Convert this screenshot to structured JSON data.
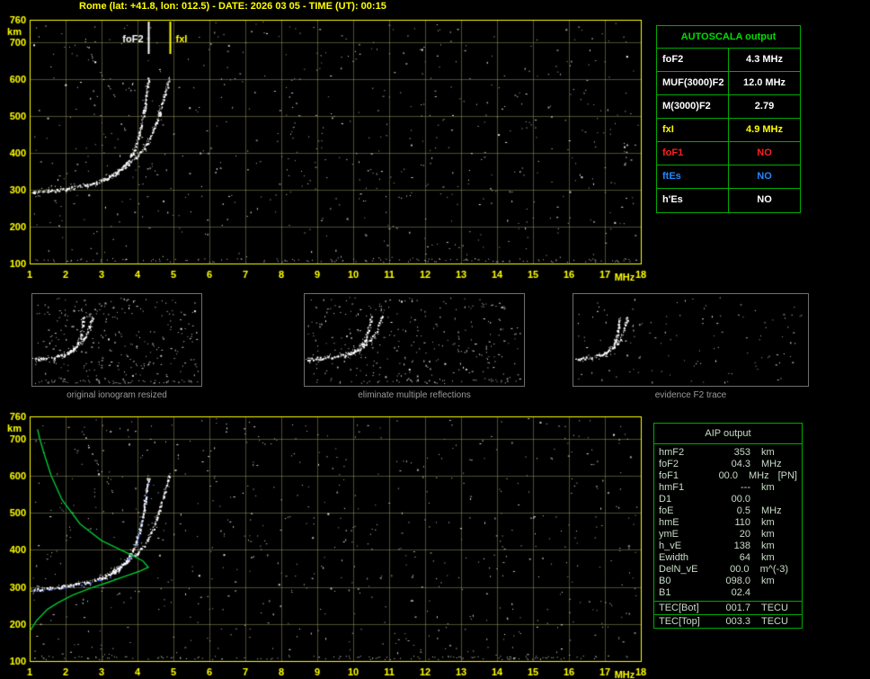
{
  "title": "Rome (lat: +41.8, lon: 012.5) - DATE: 2026 03 05 - TIME (UT): 00:15",
  "colors": {
    "background": "#000000",
    "axis_yellow": "#ffff00",
    "grid": "rgba(190,190,120,0.40)",
    "trace_white": "#ffffff",
    "profile_green": "#00c832",
    "restored_blue": "#4466ff",
    "table_green": "#00aa00",
    "table_header_green": "#00dd00",
    "caption_gray": "#9a9a9a",
    "aip_text": "#c8dcc8",
    "value_red": "#ff2020",
    "value_blue": "#2288ff",
    "value_yellow": "#ffff00",
    "value_white": "#ffffff"
  },
  "autoscala_table": {
    "header": "AUTOSCALA output",
    "rows": [
      {
        "label": "foF2",
        "value": "4.3 MHz",
        "color": "#ffffff"
      },
      {
        "label": "MUF(3000)F2",
        "value": "12.0 MHz",
        "color": "#ffffff"
      },
      {
        "label": "M(3000)F2",
        "value": "2.79",
        "color": "#ffffff"
      },
      {
        "label": "fxI",
        "value": "4.9 MHz",
        "color": "#ffff00"
      },
      {
        "label": "foF1",
        "value": "NO",
        "color": "#ff2020"
      },
      {
        "label": "ftEs",
        "value": "NO",
        "color": "#2288ff"
      },
      {
        "label": "h'Es",
        "value": "NO",
        "color": "#ffffff"
      }
    ]
  },
  "thumbnails": [
    {
      "caption": "original ionogram resized"
    },
    {
      "caption": "eliminate multiple reflections"
    },
    {
      "caption": "evidence F2 trace"
    }
  ],
  "aip_table": {
    "header": "AIP output",
    "rows": [
      {
        "label": "hmF2",
        "value": "353",
        "unit": "km",
        "extra": ""
      },
      {
        "label": "foF2",
        "value": "04.3",
        "unit": "MHz",
        "extra": ""
      },
      {
        "label": "foF1",
        "value": "00.0",
        "unit": "MHz",
        "extra": "[PN]"
      },
      {
        "label": "hmF1",
        "value": "---",
        "unit": "km",
        "extra": ""
      },
      {
        "label": "D1",
        "value": "00.0",
        "unit": "",
        "extra": ""
      },
      {
        "label": "foE",
        "value": "0.5",
        "unit": "MHz",
        "extra": ""
      },
      {
        "label": "hmE",
        "value": "110",
        "unit": "km",
        "extra": ""
      },
      {
        "label": "ymE",
        "value": "20",
        "unit": "km",
        "extra": ""
      },
      {
        "label": "h_vE",
        "value": "138",
        "unit": "km",
        "extra": ""
      },
      {
        "label": "Ewidth",
        "value": "64",
        "unit": "km",
        "extra": ""
      },
      {
        "label": "DelN_vE",
        "value": "00.0",
        "unit": "m^(-3)",
        "extra": ""
      },
      {
        "label": "B0",
        "value": "098.0",
        "unit": "km",
        "extra": ""
      },
      {
        "label": "B1",
        "value": "02.4",
        "unit": "",
        "extra": ""
      }
    ],
    "tec_rows": [
      {
        "label": "TEC[Bot]",
        "value": "001.7",
        "unit": "TECU"
      },
      {
        "label": "TEC[Top]",
        "value": "003.3",
        "unit": "TECU"
      }
    ]
  },
  "chart_data": [
    {
      "id": "main_ionogram",
      "type": "scatter",
      "xlabel": "MHz",
      "ylabel": "km",
      "xlim": [
        1,
        18
      ],
      "ylim": [
        100,
        760
      ],
      "x_ticks": [
        "1",
        "2",
        "3",
        "4",
        "5",
        "6",
        "7",
        "8",
        "9",
        "10",
        "11",
        "12",
        "13",
        "14",
        "15",
        "16",
        "17",
        "18"
      ],
      "y_ticks": [
        "760",
        "700",
        "600",
        "500",
        "400",
        "300",
        "200",
        "100"
      ],
      "grid": true,
      "markers": [
        {
          "label": "foF2",
          "freq_mhz": 4.3,
          "color": "#ffffff",
          "side": "left"
        },
        {
          "label": "fxI",
          "freq_mhz": 4.9,
          "color": "#ffff00",
          "side": "right"
        }
      ],
      "noise": {
        "seed": 7,
        "count": 650,
        "bottom_band": 140
      },
      "series": [
        {
          "name": "F2 trace O-mode",
          "style": "speckle",
          "color": "#ffffff",
          "points": [
            [
              1.05,
              292
            ],
            [
              1.5,
              297
            ],
            [
              2.0,
              303
            ],
            [
              2.5,
              312
            ],
            [
              3.0,
              324
            ],
            [
              3.4,
              344
            ],
            [
              3.7,
              372
            ],
            [
              3.9,
              408
            ],
            [
              4.05,
              452
            ],
            [
              4.15,
              500
            ],
            [
              4.22,
              545
            ],
            [
              4.28,
              583
            ],
            [
              4.31,
              602
            ]
          ]
        },
        {
          "name": "F2 trace X-mode",
          "style": "speckle",
          "color": "#ffffff",
          "points": [
            [
              3.0,
              325
            ],
            [
              3.4,
              348
            ],
            [
              3.7,
              368
            ],
            [
              4.0,
              392
            ],
            [
              4.25,
              425
            ],
            [
              4.45,
              465
            ],
            [
              4.6,
              508
            ],
            [
              4.72,
              548
            ],
            [
              4.82,
              583
            ],
            [
              4.88,
              607
            ]
          ]
        },
        {
          "name": "multiple reflection",
          "style": "speckle-sparse",
          "color": "#ffffff",
          "points": [
            [
              2.5,
              712
            ],
            [
              2.72,
              662
            ],
            [
              2.95,
              618
            ],
            [
              3.18,
              578
            ],
            [
              3.38,
              548
            ]
          ]
        }
      ]
    },
    {
      "id": "aip_ionogram",
      "type": "scatter",
      "xlabel": "MHz",
      "ylabel": "km",
      "xlim": [
        1,
        18
      ],
      "ylim": [
        100,
        760
      ],
      "x_ticks": [
        "1",
        "2",
        "3",
        "4",
        "5",
        "6",
        "7",
        "8",
        "9",
        "10",
        "11",
        "12",
        "13",
        "14",
        "15",
        "16",
        "17",
        "18"
      ],
      "y_ticks": [
        "760",
        "700",
        "600",
        "500",
        "400",
        "300",
        "200",
        "100"
      ],
      "grid": true,
      "noise": {
        "seed": 13,
        "count": 650,
        "bottom_band": 140
      },
      "series": [
        {
          "name": "restored F2 trace",
          "style": "dotted",
          "color": "#4466ff",
          "points": [
            [
              1.1,
              290
            ],
            [
              1.6,
              294
            ],
            [
              2.1,
              300
            ],
            [
              2.6,
              310
            ],
            [
              3.1,
              326
            ],
            [
              3.5,
              350
            ],
            [
              3.8,
              384
            ],
            [
              4.0,
              432
            ],
            [
              4.13,
              486
            ],
            [
              4.22,
              536
            ],
            [
              4.28,
              584
            ]
          ]
        },
        {
          "name": "F2 trace O-mode",
          "style": "speckle",
          "color": "#ffffff",
          "points": [
            [
              1.05,
              292
            ],
            [
              1.5,
              297
            ],
            [
              2.0,
              303
            ],
            [
              2.5,
              312
            ],
            [
              3.0,
              324
            ],
            [
              3.4,
              344
            ],
            [
              3.7,
              372
            ],
            [
              3.9,
              408
            ],
            [
              4.05,
              452
            ],
            [
              4.15,
              500
            ],
            [
              4.22,
              545
            ],
            [
              4.28,
              583
            ],
            [
              4.31,
              602
            ]
          ]
        },
        {
          "name": "F2 trace X-mode",
          "style": "speckle",
          "color": "#ffffff",
          "points": [
            [
              3.0,
              325
            ],
            [
              3.4,
              348
            ],
            [
              3.7,
              368
            ],
            [
              4.0,
              392
            ],
            [
              4.25,
              425
            ],
            [
              4.45,
              465
            ],
            [
              4.6,
              508
            ],
            [
              4.72,
              548
            ],
            [
              4.82,
              583
            ],
            [
              4.88,
              607
            ]
          ]
        },
        {
          "name": "multiple reflection",
          "style": "speckle-sparse",
          "color": "#ffffff",
          "points": [
            [
              2.5,
              712
            ],
            [
              2.72,
              662
            ],
            [
              2.95,
              618
            ],
            [
              3.18,
              578
            ],
            [
              3.38,
              548
            ]
          ]
        },
        {
          "name": "electron density profile",
          "style": "line",
          "color": "#00c832",
          "points": [
            [
              1.02,
              183
            ],
            [
              1.2,
              210
            ],
            [
              1.5,
              240
            ],
            [
              1.8,
              258
            ],
            [
              2.2,
              278
            ],
            [
              2.7,
              297
            ],
            [
              3.2,
              313
            ],
            [
              3.7,
              330
            ],
            [
              4.05,
              342
            ],
            [
              4.3,
              353
            ],
            [
              4.15,
              370
            ],
            [
              3.7,
              392
            ],
            [
              3.0,
              425
            ],
            [
              2.4,
              470
            ],
            [
              1.9,
              535
            ],
            [
              1.6,
              600
            ],
            [
              1.4,
              660
            ],
            [
              1.28,
              700
            ],
            [
              1.22,
              725
            ]
          ]
        }
      ]
    },
    {
      "id": "thumb_original",
      "type": "scatter",
      "xlim": [
        1,
        12
      ],
      "ylim": [
        100,
        760
      ],
      "grid": false,
      "series_from": "main_ionogram",
      "include_series": [
        0,
        1,
        2
      ],
      "noise": {
        "seed": 21,
        "count": 280,
        "bottom_band": 60
      }
    },
    {
      "id": "thumb_cleaned",
      "type": "scatter",
      "xlim": [
        1,
        12
      ],
      "ylim": [
        100,
        760
      ],
      "grid": false,
      "series_from": "main_ionogram",
      "include_series": [
        0,
        1
      ],
      "noise": {
        "seed": 22,
        "count": 300,
        "bottom_band": 45
      }
    },
    {
      "id": "thumb_trace",
      "type": "scatter",
      "xlim": [
        1,
        18
      ],
      "ylim": [
        100,
        760
      ],
      "grid": false,
      "series_from": "main_ionogram",
      "include_series": [
        0,
        1
      ],
      "noise": {
        "seed": 23,
        "count": 120,
        "bottom_band": 0
      }
    }
  ]
}
